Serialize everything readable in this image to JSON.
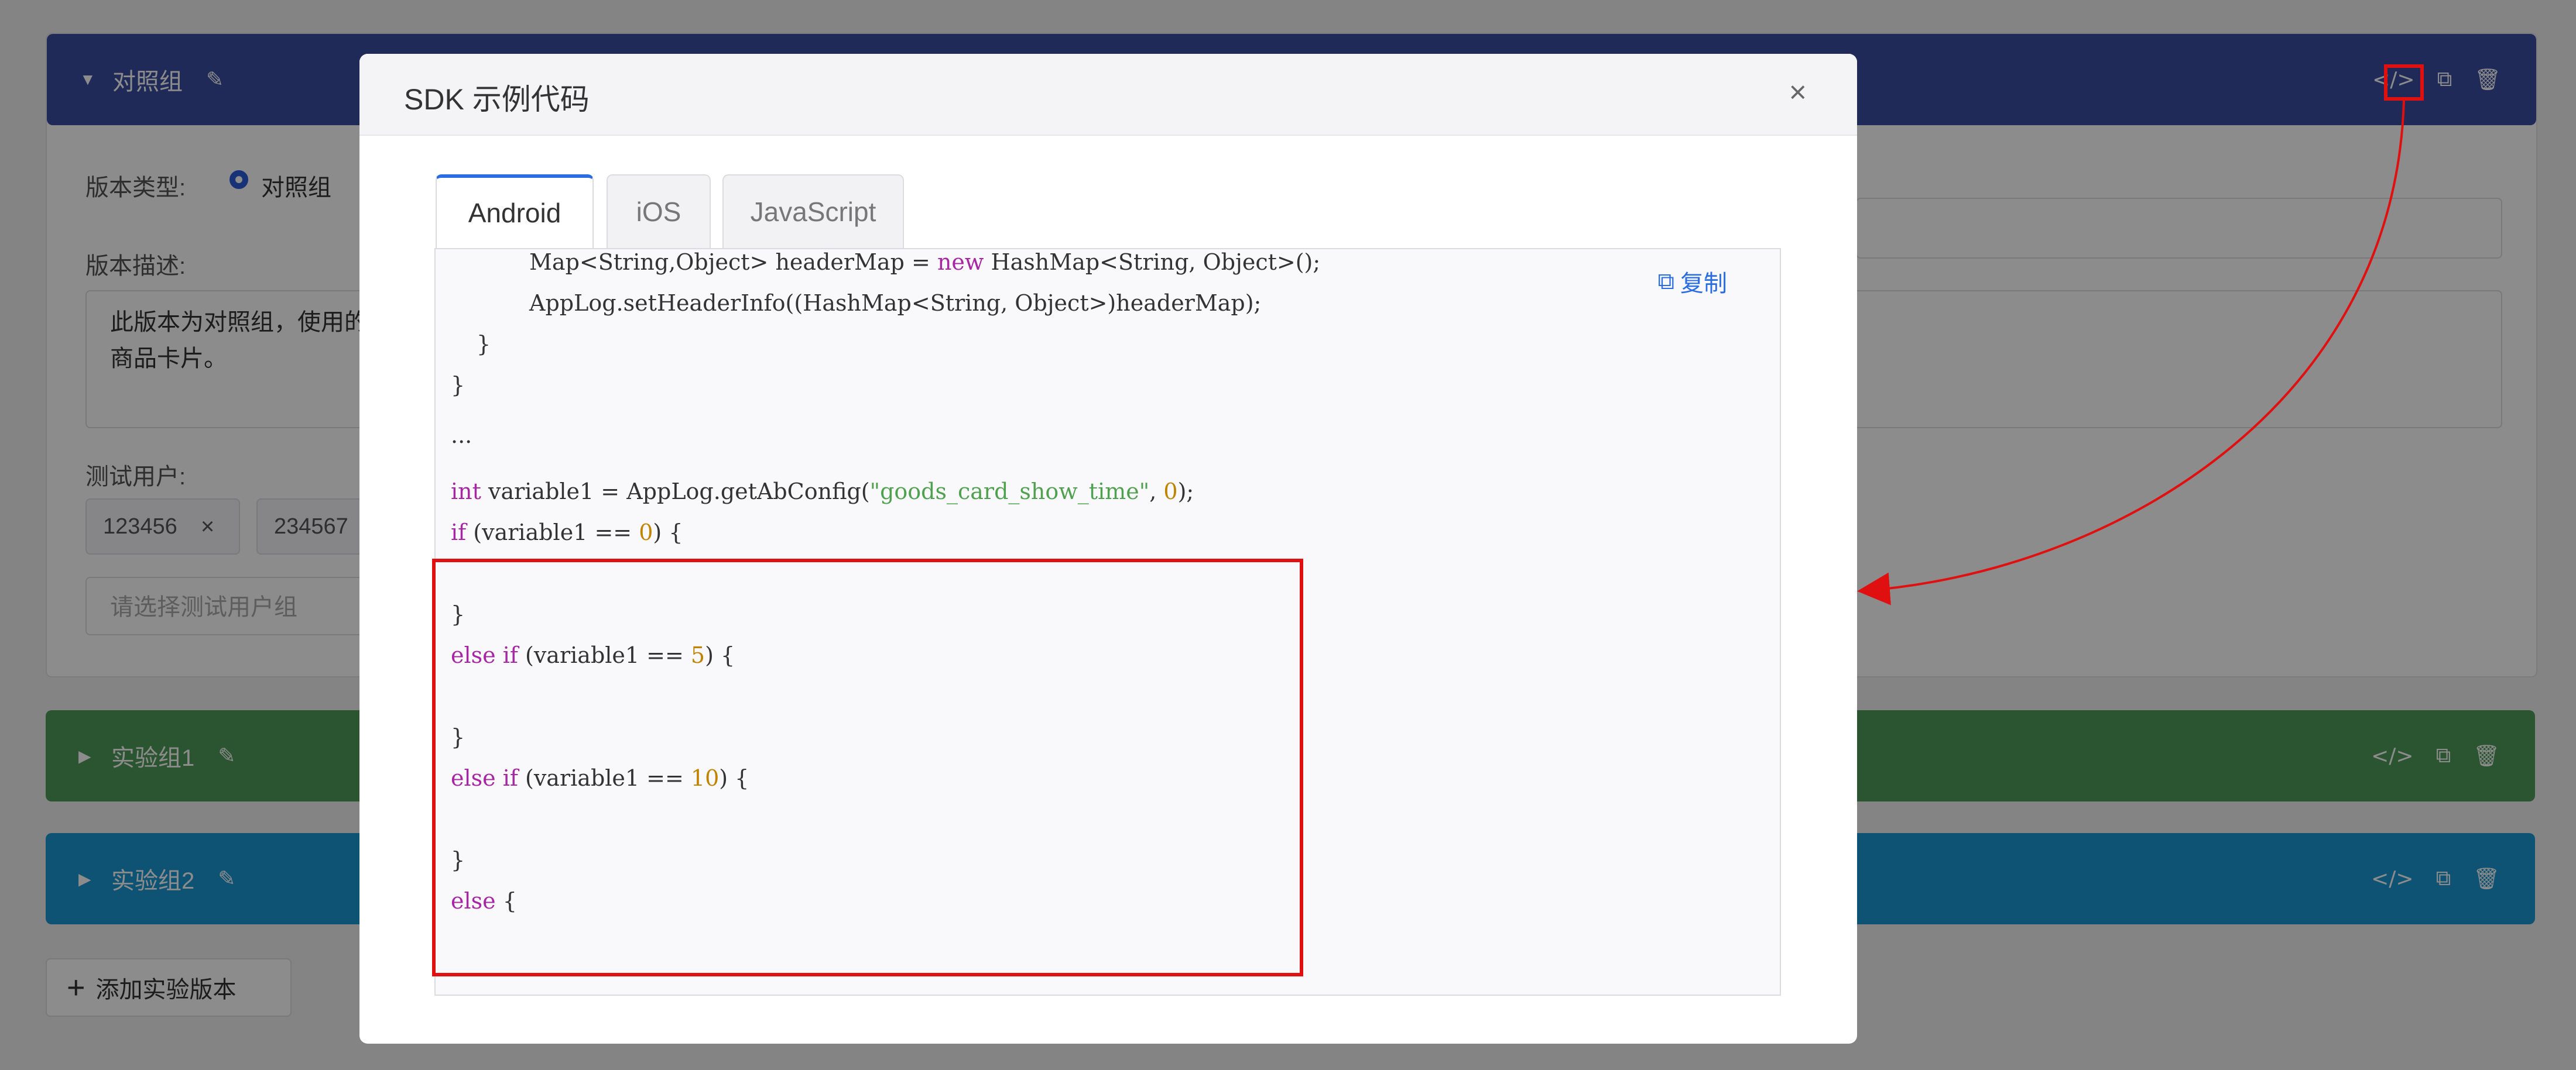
{
  "background_page": {
    "control_group": {
      "name": "对照组",
      "version_type_label": "版本类型:",
      "version_type_value": "对照组",
      "description_label": "版本描述:",
      "description_text": "此版本为对照组，使用的\n商品卡片。",
      "test_users_label": "测试用户:",
      "test_user_tags": [
        "123456",
        "234567"
      ],
      "select_placeholder": "请选择测试用户组"
    },
    "experiment_groups": [
      {
        "name": "实验组1"
      },
      {
        "name": "实验组2"
      }
    ],
    "add_version_label": "添加实验版本",
    "group_icons": {
      "code": "</>",
      "copy": "⧉",
      "delete": "🗑"
    }
  },
  "modal": {
    "title": "SDK 示例代码",
    "close_glyph": "×",
    "tabs": [
      "Android",
      "iOS",
      "JavaScript"
    ],
    "active_tab": "Android",
    "copy_label": "复制",
    "code": {
      "l1": "Map<String,Object> headerMap = ",
      "l1_kw": "new",
      "l1_rest": " HashMap<String, Object>();",
      "l2": "AppLog.setHeaderInfo((HashMap<String, Object>)headerMap);",
      "l3": "}",
      "l4": "}",
      "l5": "...",
      "l6_kw": "int",
      "l6_a": " variable1 = AppLog.getAbConfig(",
      "l6_str": "\"goods_card_show_time\"",
      "l6_b": ", ",
      "l6_num": "0",
      "l6_c": ");",
      "l7_kw": "if",
      "l7_a": " (variable1 == ",
      "l7_num": "0",
      "l7_b": ") {",
      "l8": "}",
      "l9_kw": "else if",
      "l9_a": " (variable1 == ",
      "l9_num": "5",
      "l9_b": ") {",
      "l10": "}",
      "l11_kw": "else if",
      "l11_a": " (variable1 == ",
      "l11_num": "10",
      "l11_b": ") {",
      "l12": "}",
      "l13_kw": "else",
      "l13_a": " {"
    }
  },
  "colors": {
    "control_header": "#3a4da0",
    "exp1_header": "#4f9b5a",
    "exp2_header": "#1d98d4",
    "accent": "#2a6de0",
    "highlight": "#e01010"
  }
}
